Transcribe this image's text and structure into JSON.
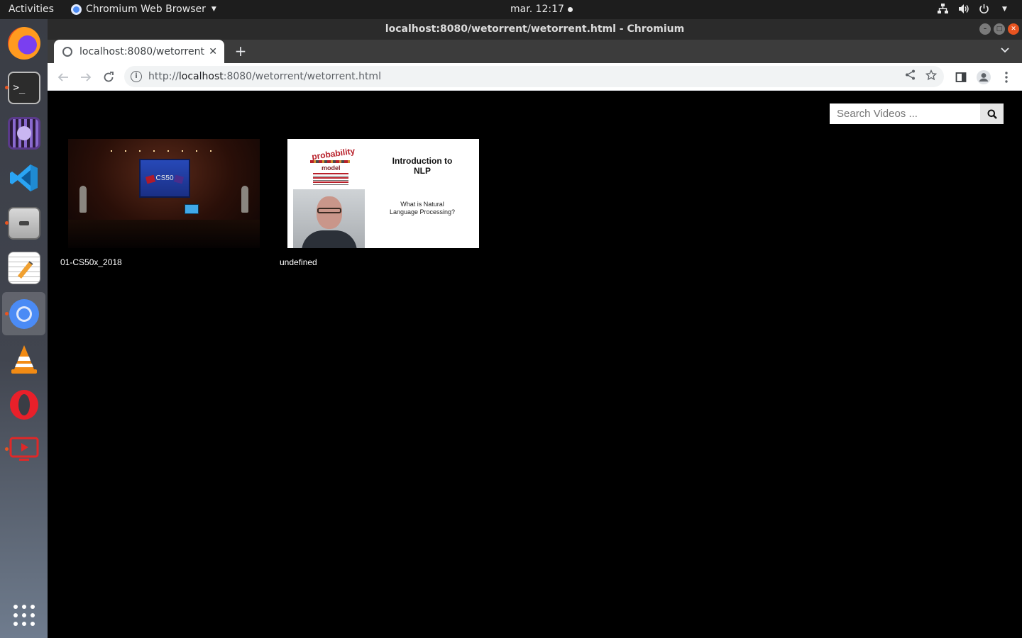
{
  "topbar": {
    "activities": "Activities",
    "app_name": "Chromium Web Browser",
    "clock": "mar. 12:17"
  },
  "dock": {
    "items": [
      "firefox",
      "terminal",
      "video-editor",
      "vscode",
      "files",
      "text-editor",
      "chromium",
      "vlc",
      "opera",
      "screen-recorder"
    ]
  },
  "window": {
    "title": "localhost:8080/wetorrent/wetorrent.html - Chromium"
  },
  "tab": {
    "title": "localhost:8080/wetorrent"
  },
  "omnibox": {
    "url_prefix": "http://",
    "url_host": "localhost",
    "url_rest": ":8080/wetorrent/wetorrent.html"
  },
  "search": {
    "placeholder": "Search Videos ..."
  },
  "videos": [
    {
      "label": "01-CS50x_2018",
      "thumb_text": "CS50"
    },
    {
      "label": "undefined",
      "slide_title": "Introduction to NLP",
      "slide_subtitle": "What is Natural Language Processing?",
      "cloud_word": "probability",
      "cloud_word2": "model"
    }
  ],
  "colors": {
    "ubuntu_orange": "#e95420",
    "page_bg": "#000000"
  }
}
